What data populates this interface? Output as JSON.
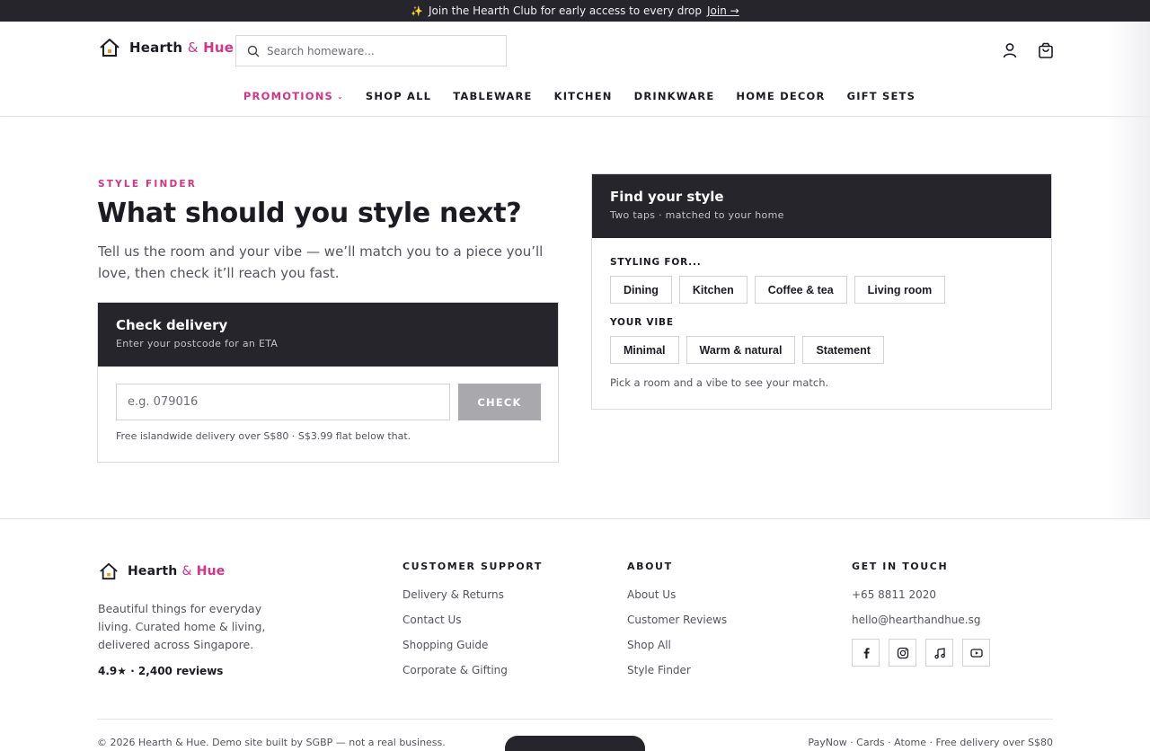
{
  "announcement": {
    "text": "Join the Hearth Club for early access to every drop",
    "link": "Join →"
  },
  "brand": {
    "name_a": "Hearth",
    "amp": "&",
    "name_b": "Hue"
  },
  "search": {
    "placeholder": "Search homeware..."
  },
  "nav": {
    "promotions": "PROMOTIONS",
    "items": [
      "SHOP ALL",
      "TABLEWARE",
      "KITCHEN",
      "DRINKWARE",
      "HOME DECOR",
      "GIFT SETS"
    ]
  },
  "hero": {
    "eyebrow": "STYLE FINDER",
    "title": "What should you style next?",
    "lede": "Tell us the room and your vibe — we’ll match you to a piece you’ll love, then check it’ll reach you fast."
  },
  "delivery": {
    "title": "Check delivery",
    "subtitle": "Enter your postcode for an ETA",
    "placeholder": "e.g. 079016",
    "button": "CHECK",
    "note": "Free islandwide delivery over S$80 · S$3.99 flat below that."
  },
  "finder": {
    "title": "Find your style",
    "subtitle": "Two taps · matched to your home",
    "styling_label": "STYLING FOR...",
    "rooms": [
      "Dining",
      "Kitchen",
      "Coffee & tea",
      "Living room"
    ],
    "vibe_label": "YOUR VIBE",
    "vibes": [
      "Minimal",
      "Warm & natural",
      "Statement"
    ],
    "note": "Pick a room and a vibe to see your match."
  },
  "footer": {
    "tagline": "Beautiful things for everyday living. Curated home & living, delivered across Singapore.",
    "rating": "4.9★ · 2,400 reviews",
    "support": {
      "heading": "CUSTOMER SUPPORT",
      "links": [
        "Delivery & Returns",
        "Contact Us",
        "Shopping Guide",
        "Corporate & Gifting"
      ]
    },
    "about": {
      "heading": "ABOUT",
      "links": [
        "About Us",
        "Customer Reviews",
        "Shop All",
        "Style Finder"
      ]
    },
    "contact": {
      "heading": "GET IN TOUCH",
      "phone": "+65 8811 2020",
      "email": "hello@hearthandhue.sg",
      "socials": [
        "facebook-icon",
        "instagram-icon",
        "tiktok-icon",
        "youtube-icon"
      ]
    },
    "copyright": "© 2026 Hearth & Hue. Demo site built by SGBP — not a real business.",
    "payments": "PayNow · Cards · Atome · Free delivery over S$80"
  },
  "colors": {
    "accent": "#d63384",
    "dark": "#26252c",
    "muted": "#55545c"
  }
}
